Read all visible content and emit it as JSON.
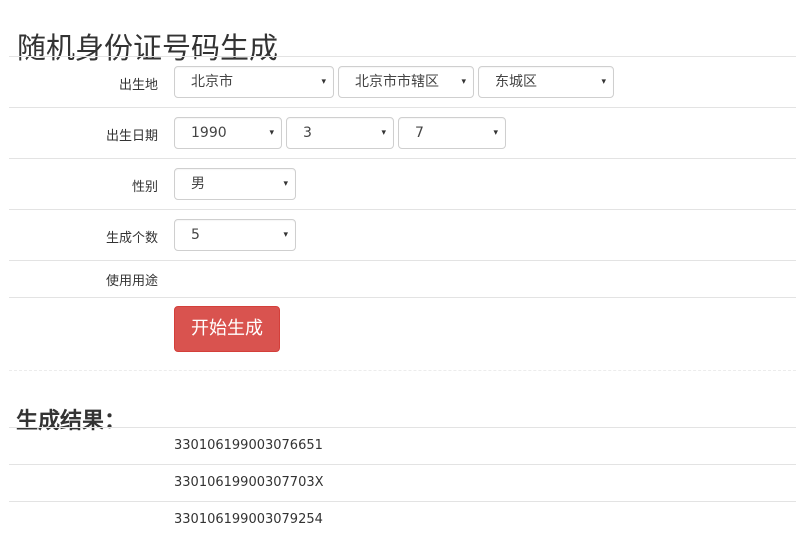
{
  "page_title": "随机身份证号码生成",
  "form": {
    "birthplace": {
      "label": "出生地",
      "province": "北京市",
      "city": "北京市市辖区",
      "district": "东城区"
    },
    "birthdate": {
      "label": "出生日期",
      "year": "1990",
      "month": "3",
      "day": "7"
    },
    "gender": {
      "label": "性别",
      "value": "男"
    },
    "count": {
      "label": "生成个数",
      "value": "5"
    },
    "purpose": {
      "label": "使用用途"
    },
    "submit_label": "开始生成"
  },
  "results": {
    "title": "生成结果：",
    "items": [
      "330106199003076651",
      "33010619900307703X",
      "330106199003079254"
    ]
  },
  "icons": {
    "dropdown_caret": "▾"
  }
}
